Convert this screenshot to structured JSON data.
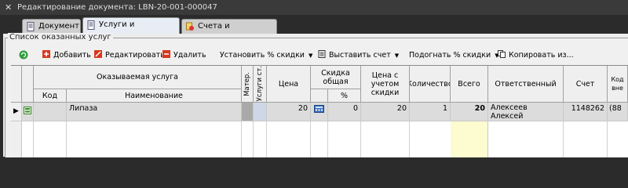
{
  "window": {
    "title": "Редактирование документа: LBN-20-001-000047"
  },
  "tabs": [
    {
      "label": "Документ"
    },
    {
      "label": "Услуги и материалы"
    },
    {
      "label": "Счета и накладные"
    }
  ],
  "group": {
    "label": "Список оказанных услуг"
  },
  "toolbar": {
    "add": "Добавить",
    "edit": "Редактировать",
    "delete": "Удалить",
    "set_discount": "Установить % скидки",
    "issue_invoice": "Выставить счет",
    "adjust_discount": "Подогнать % скидки",
    "copy": "Копировать из..."
  },
  "columns": {
    "service_group": "Оказываемая услуга",
    "code": "Код",
    "name": "Наименование",
    "mater": "Матер.",
    "services_st": "Услуги ст.",
    "price": "Цена",
    "discount_total": "Скидка общая",
    "percent": "%",
    "price_with_discount": "Цена с учетом скидки",
    "quantity": "Количество",
    "total": "Всего",
    "responsible": "Ответственный",
    "invoice": "Счет",
    "extra": "Код вне"
  },
  "rows": [
    {
      "code": "",
      "name": "Липаза",
      "price": "20",
      "discount_percent": "0",
      "price_with_discount": "20",
      "quantity": "1",
      "total": "20",
      "responsible": "Алексеев Алексей Васильевич",
      "invoice": "1148262",
      "extra": "(88"
    }
  ]
}
